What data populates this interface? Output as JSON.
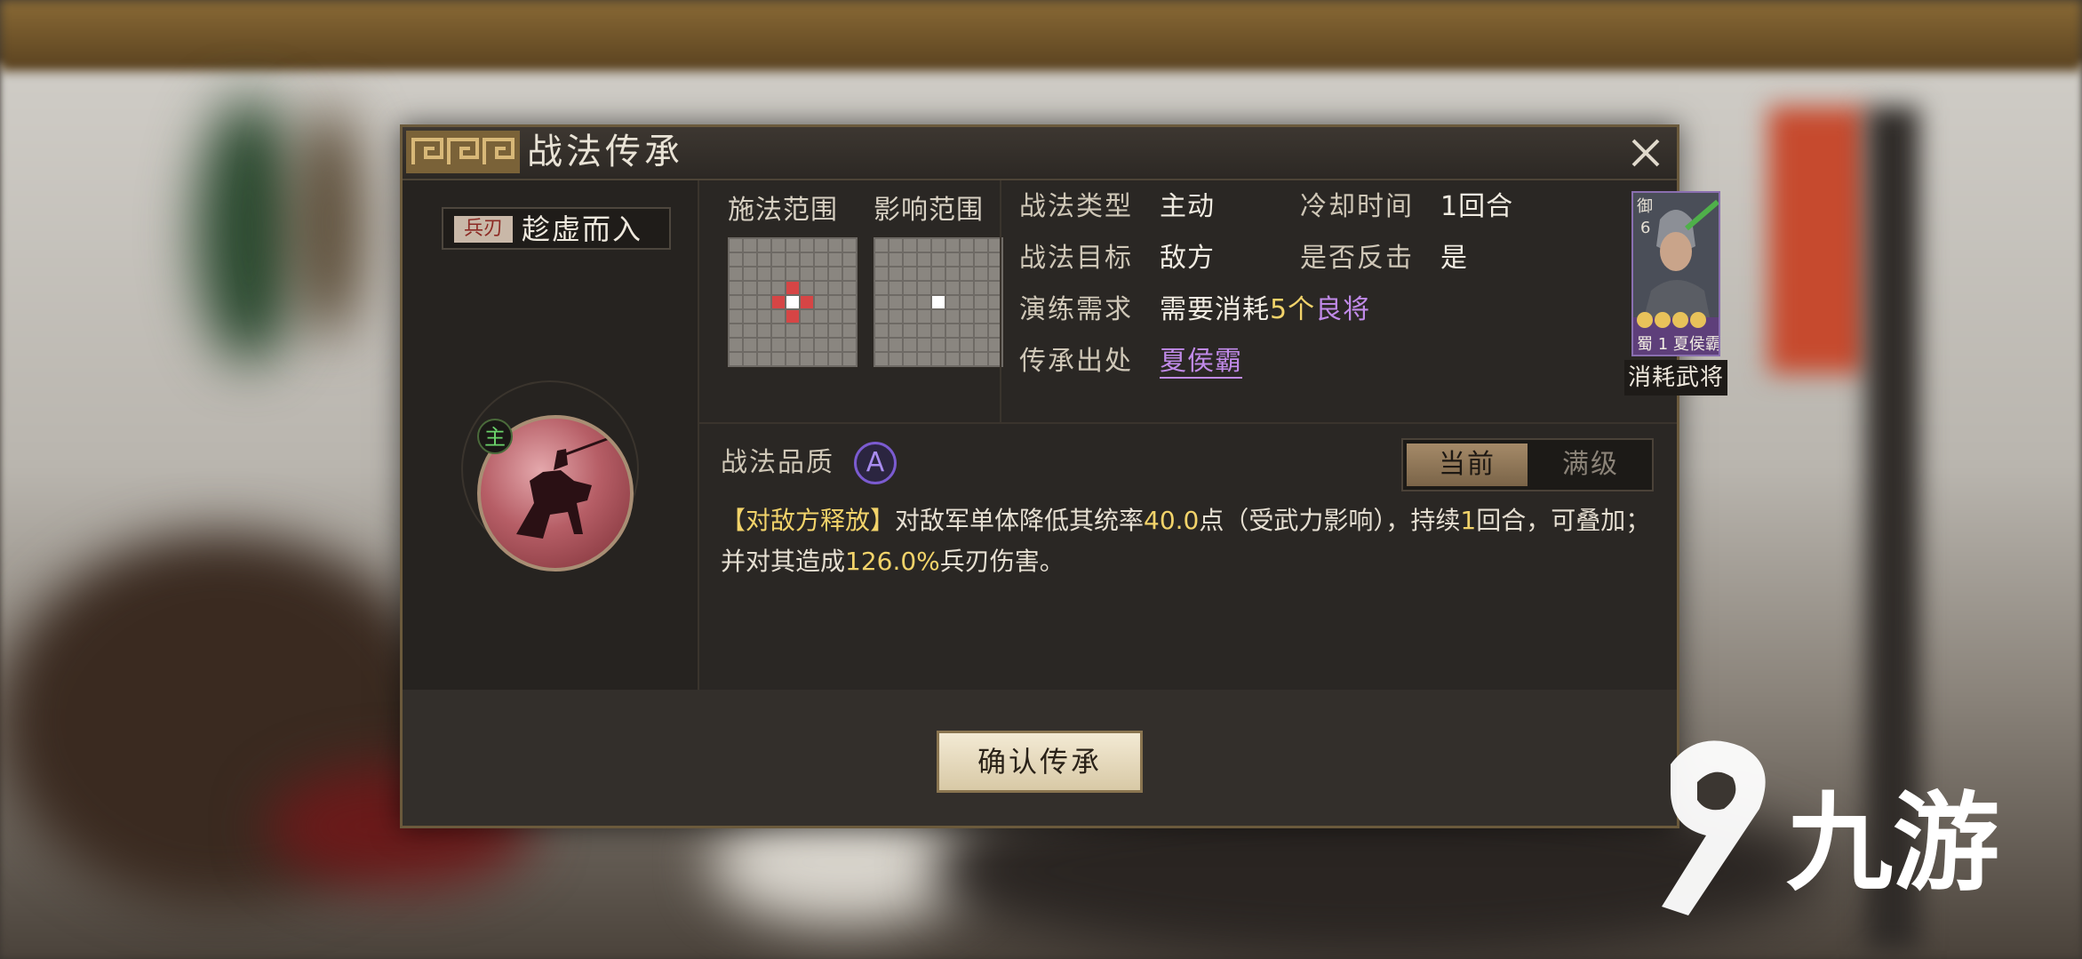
{
  "dialog": {
    "title": "战法传承",
    "close_icon": "close-icon"
  },
  "skill": {
    "type_tag": "兵刃",
    "name": "趁虚而入",
    "main_tag": "主"
  },
  "range": {
    "cast_label": "施法范围",
    "effect_label": "影响范围"
  },
  "info": {
    "skill_type_label": "战法类型",
    "skill_type_value": "主动",
    "cooldown_label": "冷却时间",
    "cooldown_value": "1回合",
    "target_label": "战法目标",
    "target_value": "敌方",
    "counter_label": "是否反击",
    "counter_value": "是",
    "practice_label": "演练需求",
    "practice_prefix": "需要消耗",
    "practice_count": "5个",
    "practice_item": "良将",
    "source_label": "传承出处",
    "source_value": "夏侯霸"
  },
  "general_card": {
    "faction": "蜀",
    "level": "1",
    "name": "夏侯霸",
    "cost": "6",
    "role_tag": "御",
    "caption": "消耗武将"
  },
  "quality": {
    "label": "战法品质",
    "grade": "A"
  },
  "toggle": {
    "current": "当前",
    "max": "满级"
  },
  "description": {
    "tag": "【对敌方释放】",
    "part1": "对敌军单体降低其统率",
    "value1": "40.0",
    "part2": "点（受武力影响），持续",
    "value2": "1",
    "part3": "回合，可叠加；并对其造成",
    "value3": "126.0%",
    "part4": "兵刃伤害。"
  },
  "footer": {
    "confirm_label": "确认传承"
  },
  "watermark": {
    "text": "九游"
  },
  "colors": {
    "accent_yellow": "#f2d36a",
    "accent_purple": "#c08ae8",
    "grid_red": "#d64545"
  }
}
